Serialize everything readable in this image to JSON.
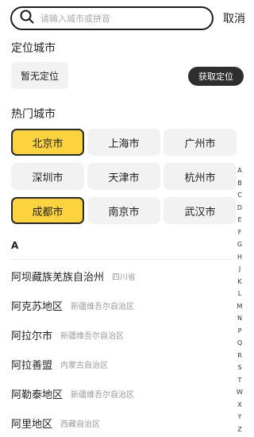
{
  "search": {
    "placeholder": "请输入城市或拼音",
    "cancel_label": "取消"
  },
  "location": {
    "title": "定位城市",
    "status": "暂无定位",
    "get_label": "获取定位"
  },
  "hot": {
    "title": "热门城市",
    "cities": [
      {
        "name": "北京市",
        "selected": true
      },
      {
        "name": "上海市",
        "selected": false
      },
      {
        "name": "广州市",
        "selected": false
      },
      {
        "name": "深圳市",
        "selected": false
      },
      {
        "name": "天津市",
        "selected": false
      },
      {
        "name": "杭州市",
        "selected": false
      },
      {
        "name": "成都市",
        "selected": true
      },
      {
        "name": "南京市",
        "selected": false
      },
      {
        "name": "武汉市",
        "selected": false
      }
    ]
  },
  "index_letters": [
    "A",
    "B",
    "C",
    "D",
    "E",
    "F",
    "G",
    "H",
    "J",
    "K",
    "L",
    "M",
    "N",
    "P",
    "Q",
    "R",
    "S",
    "T",
    "W",
    "X",
    "Y",
    "Z"
  ],
  "list": {
    "letter": "A",
    "cities": [
      {
        "name": "阿坝藏族羌族自治州",
        "province": "四川省"
      },
      {
        "name": "阿克苏地区",
        "province": "新疆维吾尔自治区"
      },
      {
        "name": "阿拉尔市",
        "province": "新疆维吾尔自治区"
      },
      {
        "name": "阿拉善盟",
        "province": "内蒙古自治区"
      },
      {
        "name": "阿勒泰地区",
        "province": "新疆维吾尔自治区"
      },
      {
        "name": "阿里地区",
        "province": "西藏自治区"
      }
    ]
  },
  "colors": {
    "accent": "#fcd33f",
    "dark": "#2e2e2e",
    "chip": "#f2f2f2"
  }
}
